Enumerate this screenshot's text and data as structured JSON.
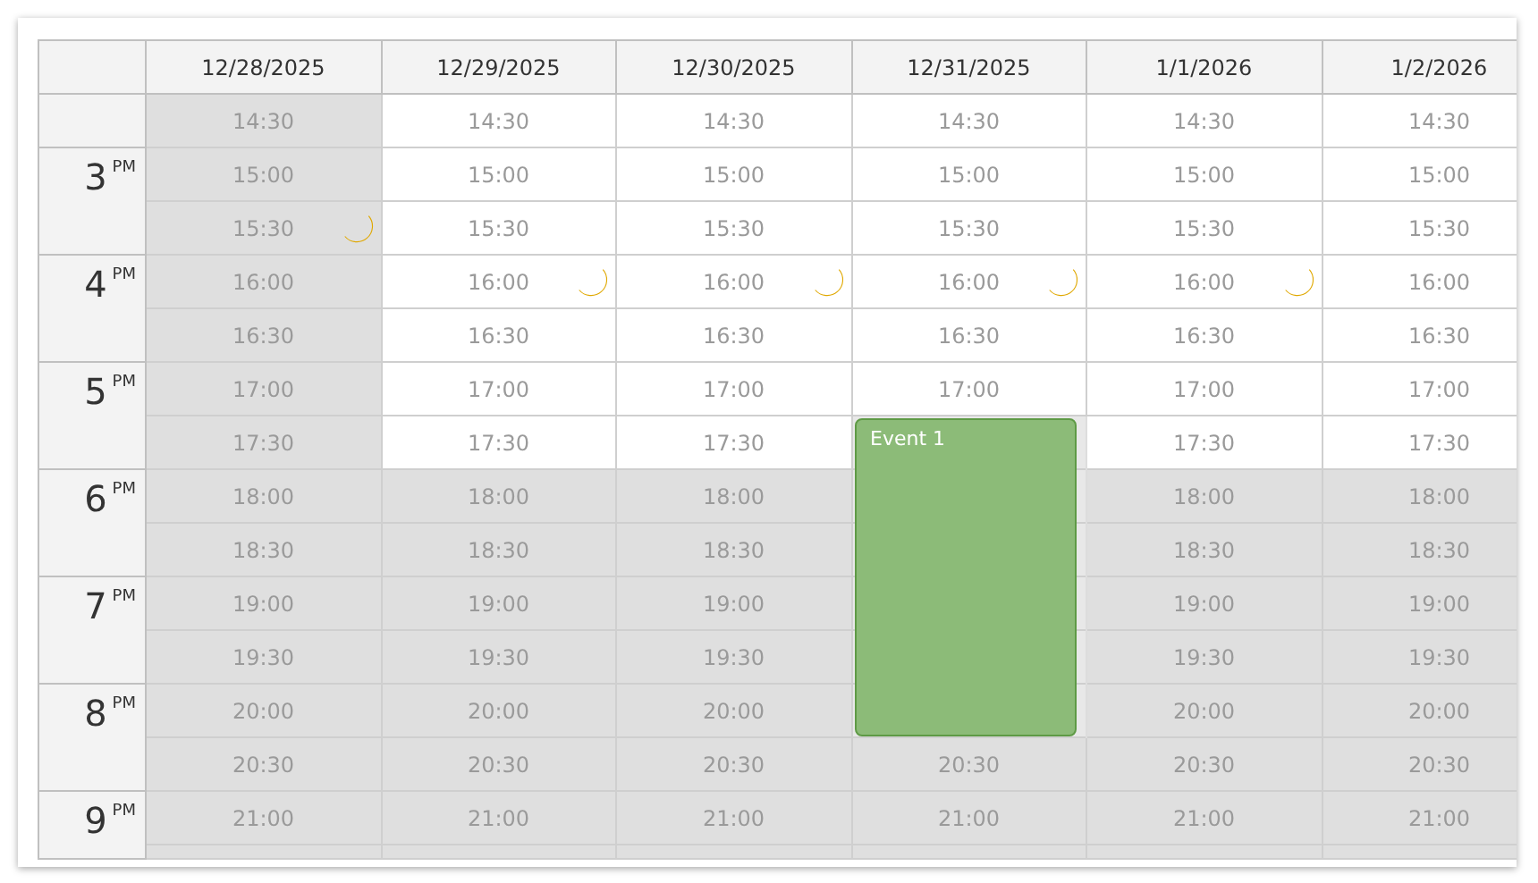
{
  "columns": [
    {
      "date": "12/28/2025"
    },
    {
      "date": "12/29/2025"
    },
    {
      "date": "12/30/2025"
    },
    {
      "date": "12/31/2025"
    },
    {
      "date": "1/1/2026"
    },
    {
      "date": "1/2/2026"
    }
  ],
  "hours": [
    {
      "hour": "3",
      "suffix": "PM"
    },
    {
      "hour": "4",
      "suffix": "PM"
    },
    {
      "hour": "5",
      "suffix": "PM"
    },
    {
      "hour": "6",
      "suffix": "PM"
    },
    {
      "hour": "7",
      "suffix": "PM"
    },
    {
      "hour": "8",
      "suffix": "PM"
    },
    {
      "hour": "9",
      "suffix": "PM"
    }
  ],
  "rows": [
    {
      "cells": [
        {
          "time": "14:30",
          "shaded": true,
          "sunset": false
        },
        {
          "time": "14:30",
          "shaded": false,
          "sunset": false
        },
        {
          "time": "14:30",
          "shaded": false,
          "sunset": false
        },
        {
          "time": "14:30",
          "shaded": false,
          "sunset": false
        },
        {
          "time": "14:30",
          "shaded": false,
          "sunset": false
        },
        {
          "time": "14:30",
          "shaded": false,
          "sunset": false
        }
      ]
    },
    {
      "cells": [
        {
          "time": "15:00",
          "shaded": true,
          "sunset": false
        },
        {
          "time": "15:00",
          "shaded": false,
          "sunset": false
        },
        {
          "time": "15:00",
          "shaded": false,
          "sunset": false
        },
        {
          "time": "15:00",
          "shaded": false,
          "sunset": false
        },
        {
          "time": "15:00",
          "shaded": false,
          "sunset": false
        },
        {
          "time": "15:00",
          "shaded": false,
          "sunset": false
        }
      ]
    },
    {
      "cells": [
        {
          "time": "15:30",
          "shaded": true,
          "sunset": true
        },
        {
          "time": "15:30",
          "shaded": false,
          "sunset": false
        },
        {
          "time": "15:30",
          "shaded": false,
          "sunset": false
        },
        {
          "time": "15:30",
          "shaded": false,
          "sunset": false
        },
        {
          "time": "15:30",
          "shaded": false,
          "sunset": false
        },
        {
          "time": "15:30",
          "shaded": false,
          "sunset": false
        }
      ]
    },
    {
      "cells": [
        {
          "time": "16:00",
          "shaded": true,
          "sunset": false
        },
        {
          "time": "16:00",
          "shaded": false,
          "sunset": true
        },
        {
          "time": "16:00",
          "shaded": false,
          "sunset": true
        },
        {
          "time": "16:00",
          "shaded": false,
          "sunset": true
        },
        {
          "time": "16:00",
          "shaded": false,
          "sunset": true
        },
        {
          "time": "16:00",
          "shaded": false,
          "sunset": false
        }
      ]
    },
    {
      "cells": [
        {
          "time": "16:30",
          "shaded": true,
          "sunset": false
        },
        {
          "time": "16:30",
          "shaded": false,
          "sunset": false
        },
        {
          "time": "16:30",
          "shaded": false,
          "sunset": false
        },
        {
          "time": "16:30",
          "shaded": false,
          "sunset": false
        },
        {
          "time": "16:30",
          "shaded": false,
          "sunset": false
        },
        {
          "time": "16:30",
          "shaded": false,
          "sunset": false
        }
      ]
    },
    {
      "cells": [
        {
          "time": "17:00",
          "shaded": true,
          "sunset": false
        },
        {
          "time": "17:00",
          "shaded": false,
          "sunset": false
        },
        {
          "time": "17:00",
          "shaded": false,
          "sunset": false
        },
        {
          "time": "17:00",
          "shaded": false,
          "sunset": false
        },
        {
          "time": "17:00",
          "shaded": false,
          "sunset": false
        },
        {
          "time": "17:00",
          "shaded": false,
          "sunset": false
        }
      ]
    },
    {
      "cells": [
        {
          "time": "17:30",
          "shaded": true,
          "sunset": false
        },
        {
          "time": "17:30",
          "shaded": false,
          "sunset": false
        },
        {
          "time": "17:30",
          "shaded": false,
          "sunset": false
        },
        {
          "event": "Event 1"
        },
        {
          "time": "17:30",
          "shaded": false,
          "sunset": false
        },
        {
          "time": "17:30",
          "shaded": false,
          "sunset": false
        }
      ]
    },
    {
      "cells": [
        {
          "time": "18:00",
          "shaded": true,
          "sunset": false
        },
        {
          "time": "18:00",
          "shaded": true,
          "sunset": false
        },
        {
          "time": "18:00",
          "shaded": true,
          "sunset": false
        },
        {
          "event_continues": true
        },
        {
          "time": "18:00",
          "shaded": true,
          "sunset": false
        },
        {
          "time": "18:00",
          "shaded": true,
          "sunset": false
        }
      ]
    },
    {
      "cells": [
        {
          "time": "18:30",
          "shaded": true,
          "sunset": false
        },
        {
          "time": "18:30",
          "shaded": true,
          "sunset": false
        },
        {
          "time": "18:30",
          "shaded": true,
          "sunset": false
        },
        {
          "event_continues": true
        },
        {
          "time": "18:30",
          "shaded": true,
          "sunset": false
        },
        {
          "time": "18:30",
          "shaded": true,
          "sunset": false
        }
      ]
    },
    {
      "cells": [
        {
          "time": "19:00",
          "shaded": true,
          "sunset": false
        },
        {
          "time": "19:00",
          "shaded": true,
          "sunset": false
        },
        {
          "time": "19:00",
          "shaded": true,
          "sunset": false
        },
        {
          "event_continues": true
        },
        {
          "time": "19:00",
          "shaded": true,
          "sunset": false
        },
        {
          "time": "19:00",
          "shaded": true,
          "sunset": false
        }
      ]
    },
    {
      "cells": [
        {
          "time": "19:30",
          "shaded": true,
          "sunset": false
        },
        {
          "time": "19:30",
          "shaded": true,
          "sunset": false
        },
        {
          "time": "19:30",
          "shaded": true,
          "sunset": false
        },
        {
          "event_continues": true
        },
        {
          "time": "19:30",
          "shaded": true,
          "sunset": false
        },
        {
          "time": "19:30",
          "shaded": true,
          "sunset": false
        }
      ]
    },
    {
      "cells": [
        {
          "time": "20:00",
          "shaded": true,
          "sunset": false
        },
        {
          "time": "20:00",
          "shaded": true,
          "sunset": false
        },
        {
          "time": "20:00",
          "shaded": true,
          "sunset": false
        },
        {
          "event_continues": true
        },
        {
          "time": "20:00",
          "shaded": true,
          "sunset": false
        },
        {
          "time": "20:00",
          "shaded": true,
          "sunset": false
        }
      ]
    },
    {
      "cells": [
        {
          "time": "20:30",
          "shaded": true,
          "sunset": false
        },
        {
          "time": "20:30",
          "shaded": true,
          "sunset": false
        },
        {
          "time": "20:30",
          "shaded": true,
          "sunset": false
        },
        {
          "time": "20:30",
          "shaded": true,
          "sunset": false
        },
        {
          "time": "20:30",
          "shaded": true,
          "sunset": false
        },
        {
          "time": "20:30",
          "shaded": true,
          "sunset": false
        }
      ]
    },
    {
      "cells": [
        {
          "time": "21:00",
          "shaded": true,
          "sunset": false
        },
        {
          "time": "21:00",
          "shaded": true,
          "sunset": false
        },
        {
          "time": "21:00",
          "shaded": true,
          "sunset": false
        },
        {
          "time": "21:00",
          "shaded": true,
          "sunset": false
        },
        {
          "time": "21:00",
          "shaded": true,
          "sunset": false
        },
        {
          "time": "21:00",
          "shaded": true,
          "sunset": false
        }
      ]
    }
  ]
}
